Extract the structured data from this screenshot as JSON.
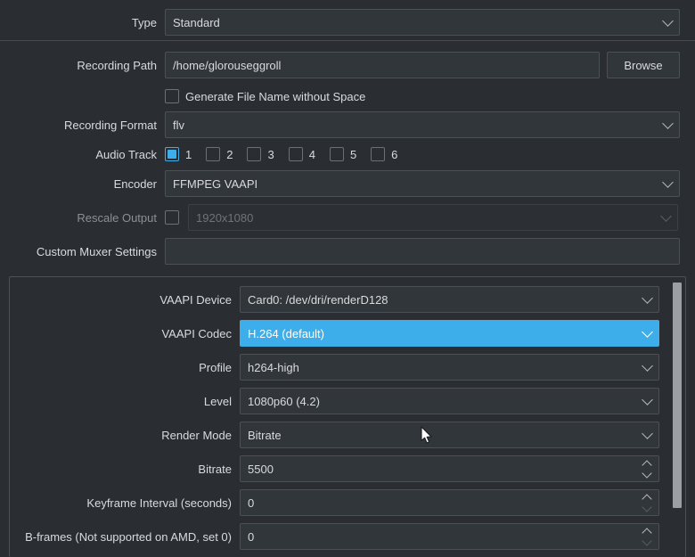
{
  "theme": {
    "window_bg": "#2a2e32",
    "field_bg": "#31363b",
    "border": "#4b5158",
    "text": "#d8dade",
    "accent": "#3daee9",
    "disabled_text": "#6e747a",
    "scrollbar_thumb": "#9b9fa4"
  },
  "form": {
    "type": {
      "label": "Type",
      "value": "Standard"
    },
    "recording_path": {
      "label": "Recording Path",
      "value": "/home/glorouseggroll",
      "browse_label": "Browse"
    },
    "generate_no_space": {
      "label": "Generate File Name without Space",
      "checked": false
    },
    "recording_format": {
      "label": "Recording Format",
      "value": "flv"
    },
    "audio_track": {
      "label": "Audio Track",
      "tracks": [
        {
          "num": "1",
          "checked": true
        },
        {
          "num": "2",
          "checked": false
        },
        {
          "num": "3",
          "checked": false
        },
        {
          "num": "4",
          "checked": false
        },
        {
          "num": "5",
          "checked": false
        },
        {
          "num": "6",
          "checked": false
        }
      ]
    },
    "encoder": {
      "label": "Encoder",
      "value": "FFMPEG VAAPI"
    },
    "rescale_output": {
      "label": "Rescale Output",
      "checked": false,
      "value": "1920x1080",
      "enabled": false
    },
    "custom_muxer": {
      "label": "Custom Muxer Settings",
      "value": ""
    }
  },
  "encoder_panel": {
    "vaapi_device": {
      "label": "VAAPI Device",
      "value": "Card0: /dev/dri/renderD128"
    },
    "vaapi_codec": {
      "label": "VAAPI Codec",
      "value": "H.264 (default)",
      "highlighted": true
    },
    "profile": {
      "label": "Profile",
      "value": "h264-high"
    },
    "level": {
      "label": "Level",
      "value": "1080p60 (4.2)"
    },
    "render_mode": {
      "label": "Render Mode",
      "value": "Bitrate"
    },
    "bitrate": {
      "label": "Bitrate",
      "value": "5500"
    },
    "keyframe_interval": {
      "label": "Keyframe Interval (seconds)",
      "value": "0"
    },
    "bframes": {
      "label": "B-frames (Not supported on AMD, set 0)",
      "value": "0"
    }
  }
}
